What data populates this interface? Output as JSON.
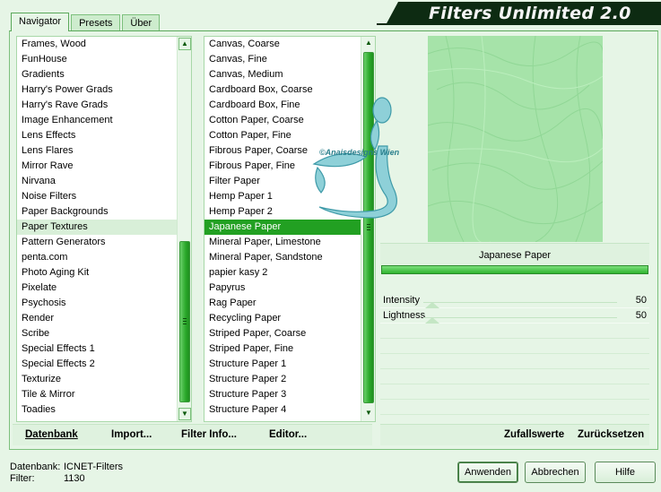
{
  "title": "Filters Unlimited 2.0",
  "tabs": [
    {
      "label": "Navigator",
      "active": true
    },
    {
      "label": "Presets",
      "active": false
    },
    {
      "label": "Über",
      "active": false
    }
  ],
  "categories": [
    "Frames, Wood",
    "FunHouse",
    "Gradients",
    "Harry's Power Grads",
    "Harry's Rave Grads",
    "Image Enhancement",
    "Lens Effects",
    "Lens Flares",
    "Mirror Rave",
    "Nirvana",
    "Noise Filters",
    "Paper Backgrounds",
    "Paper Textures",
    "Pattern Generators",
    "penta.com",
    "Photo Aging Kit",
    "Pixelate",
    "Psychosis",
    "Render",
    "Scribe",
    "Special Effects 1",
    "Special Effects 2",
    "Texturize",
    "Tile & Mirror",
    "Toadies"
  ],
  "selected_category": "Paper Textures",
  "filters": [
    "Canvas, Coarse",
    "Canvas, Fine",
    "Canvas, Medium",
    "Cardboard Box, Coarse",
    "Cardboard Box, Fine",
    "Cotton Paper, Coarse",
    "Cotton Paper, Fine",
    "Fibrous Paper, Coarse",
    "Fibrous Paper, Fine",
    "Filter Paper",
    "Hemp Paper 1",
    "Hemp Paper 2",
    "Japanese Paper",
    "Mineral Paper, Limestone",
    "Mineral Paper, Sandstone",
    "papier kasy 2",
    "Papyrus",
    "Rag Paper",
    "Recycling Paper",
    "Striped Paper, Coarse",
    "Striped Paper, Fine",
    "Structure Paper 1",
    "Structure Paper 2",
    "Structure Paper 3",
    "Structure Paper 4"
  ],
  "selected_filter": "Japanese Paper",
  "preview_watermark": "©Anaisdesigns Wien",
  "filter_name": "Japanese Paper",
  "sliders": [
    {
      "label": "Intensity",
      "value": "50"
    },
    {
      "label": "Lightness",
      "value": "50"
    }
  ],
  "links_left": {
    "datenbank": "Datenbank",
    "import": "Import...",
    "filter_info": "Filter Info...",
    "editor": "Editor..."
  },
  "links_right": {
    "zufallswerte": "Zufallswerte",
    "zuruecksetzen": "Zurücksetzen"
  },
  "status": {
    "database_label": "Datenbank:",
    "database_value": "ICNET-Filters",
    "filter_label": "Filter:",
    "filter_value": "1130"
  },
  "buttons": {
    "apply": "Anwenden",
    "cancel": "Abbrechen",
    "help": "Hilfe"
  },
  "colors": {
    "accent": "#22a022",
    "banner": "#0d2b12",
    "background": "#e6f5e6",
    "preview": "#a6e3a9"
  }
}
